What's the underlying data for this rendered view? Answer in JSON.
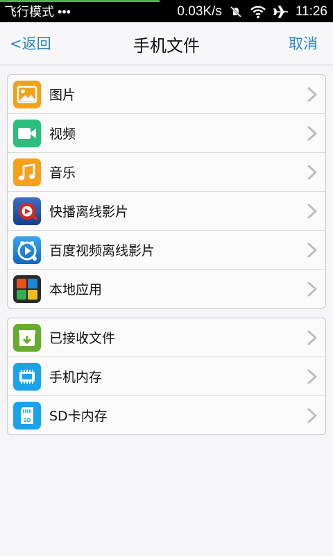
{
  "status_bar": {
    "mode_text": "飞行模式",
    "dots": "•••",
    "speed": "0.03K/s",
    "time": "11:26",
    "download_progress": 0.48
  },
  "nav": {
    "back_label": "<返回",
    "title": "手机文件",
    "cancel_label": "取消"
  },
  "groups": [
    {
      "items": [
        {
          "label": "图片",
          "icon": "picture-icon",
          "color": "#f0a21a"
        },
        {
          "label": "视频",
          "icon": "video-icon",
          "color": "#2bbf7e"
        },
        {
          "label": "音乐",
          "icon": "music-icon",
          "color": "#f6a01c"
        },
        {
          "label": "快播离线影片",
          "icon": "qvod-icon",
          "color": "#1f4fa6"
        },
        {
          "label": "百度视频离线影片",
          "icon": "baidu-video-icon",
          "color": "#1c86d8"
        },
        {
          "label": "本地应用",
          "icon": "apps-icon",
          "color": "#333333"
        }
      ]
    },
    {
      "items": [
        {
          "label": "已接收文件",
          "icon": "received-files-icon",
          "color": "#67ac2e"
        },
        {
          "label": "手机内存",
          "icon": "phone-memory-icon",
          "color": "#1aa3e8"
        },
        {
          "label": "SD卡内存",
          "icon": "sd-card-icon",
          "color": "#1aa3e8"
        }
      ]
    }
  ]
}
